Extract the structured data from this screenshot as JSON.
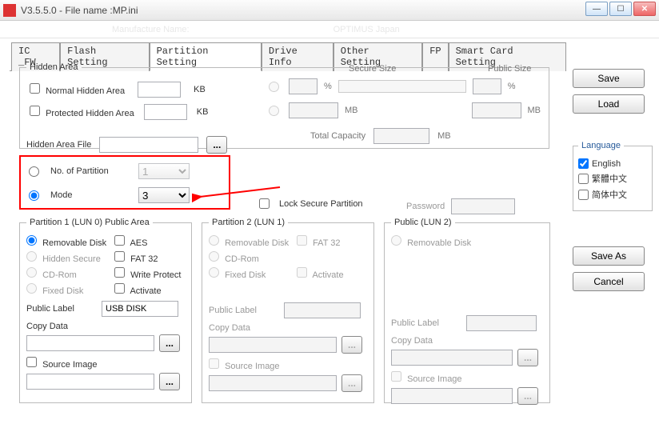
{
  "window": {
    "title": "V3.5.5.0 - File name :MP.ini"
  },
  "ghost": {
    "a": "Manufacture Name:",
    "b": "OPTIMUS    Japan"
  },
  "tabs": [
    "IC _FW",
    "Flash Setting",
    "Partition Setting",
    "Drive Info",
    "Other Setting",
    "FP",
    "Smart Card Setting"
  ],
  "activeTab": 2,
  "hiddenArea": {
    "legend": "Hidden Area",
    "normal": "Normal Hidden Area",
    "kb": "KB",
    "protected": "Protected Hidden Area",
    "fileLabel": "Hidden Area File",
    "browse": "..."
  },
  "sizes": {
    "secureLabel": "Secure Size",
    "publicLabel": "Public Size",
    "pct": "%",
    "mb": "MB",
    "totalLabel": "Total Capacity"
  },
  "partitionSel": {
    "noLabel": "No. of Partition",
    "noValue": "1",
    "modeLabel": "Mode",
    "modeValue": "3",
    "lock": "Lock Secure Partition",
    "password": "Password"
  },
  "p1": {
    "legend": "Partition 1 (LUN 0) Public Area",
    "removable": "Removable Disk",
    "aes": "AES",
    "hidden": "Hidden Secure",
    "fat32": "FAT 32",
    "cdrom": "CD-Rom",
    "wp": "Write Protect",
    "fixed": "Fixed Disk",
    "activate": "Activate",
    "publicLabel": "Public Label",
    "publicValue": "USB DISK",
    "copyData": "Copy Data",
    "browse": "...",
    "source": "Source Image"
  },
  "p2": {
    "legend": "Partition 2 (LUN 1)",
    "removable": "Removable Disk",
    "fat32": "FAT 32",
    "cdrom": "CD-Rom",
    "fixed": "Fixed Disk",
    "activate": "Activate",
    "publicLabel": "Public Label",
    "copyData": "Copy Data",
    "browse": "...",
    "source": "Source Image"
  },
  "p3": {
    "legend": "Public (LUN 2)",
    "removable": "Removable Disk",
    "publicLabel": "Public Label",
    "copyData": "Copy Data",
    "browse": "...",
    "source": "Source Image"
  },
  "side": {
    "save": "Save",
    "load": "Load",
    "saveAs": "Save As",
    "cancel": "Cancel",
    "langLegend": "Language",
    "english": "English",
    "tc": "繁體中文",
    "sc": "简体中文"
  }
}
